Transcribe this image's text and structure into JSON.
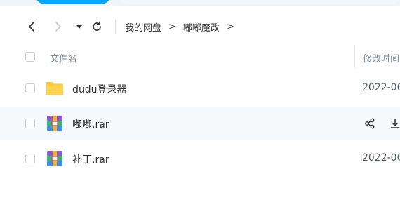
{
  "toolbar": {
    "back_icon": "chevron-left-icon",
    "forward_icon": "chevron-right-icon",
    "dropdown_icon": "caret-down-icon",
    "refresh_icon": "refresh-icon"
  },
  "breadcrumb": {
    "items": [
      "我的网盘",
      "嘟嘟魔改"
    ],
    "separator": ">"
  },
  "table": {
    "columns": {
      "name": "文件名",
      "mtime": "修改时间"
    },
    "rows": [
      {
        "name": "dudu登录器",
        "type": "folder",
        "icon": "folder-icon",
        "date": "2022-06"
      },
      {
        "name": "嘟嘟.rar",
        "type": "rar",
        "icon": "rar-archive-icon",
        "date": "",
        "hovered": true,
        "actions": [
          "share-icon",
          "download-icon"
        ]
      },
      {
        "name": "补丁.rar",
        "type": "rar",
        "icon": "rar-archive-icon",
        "date": "2022-06"
      }
    ]
  },
  "colors": {
    "accent": "#06a7ff",
    "folder": "#ffc940",
    "row_hover": "#f7f8fa",
    "header_text": "#818999"
  }
}
